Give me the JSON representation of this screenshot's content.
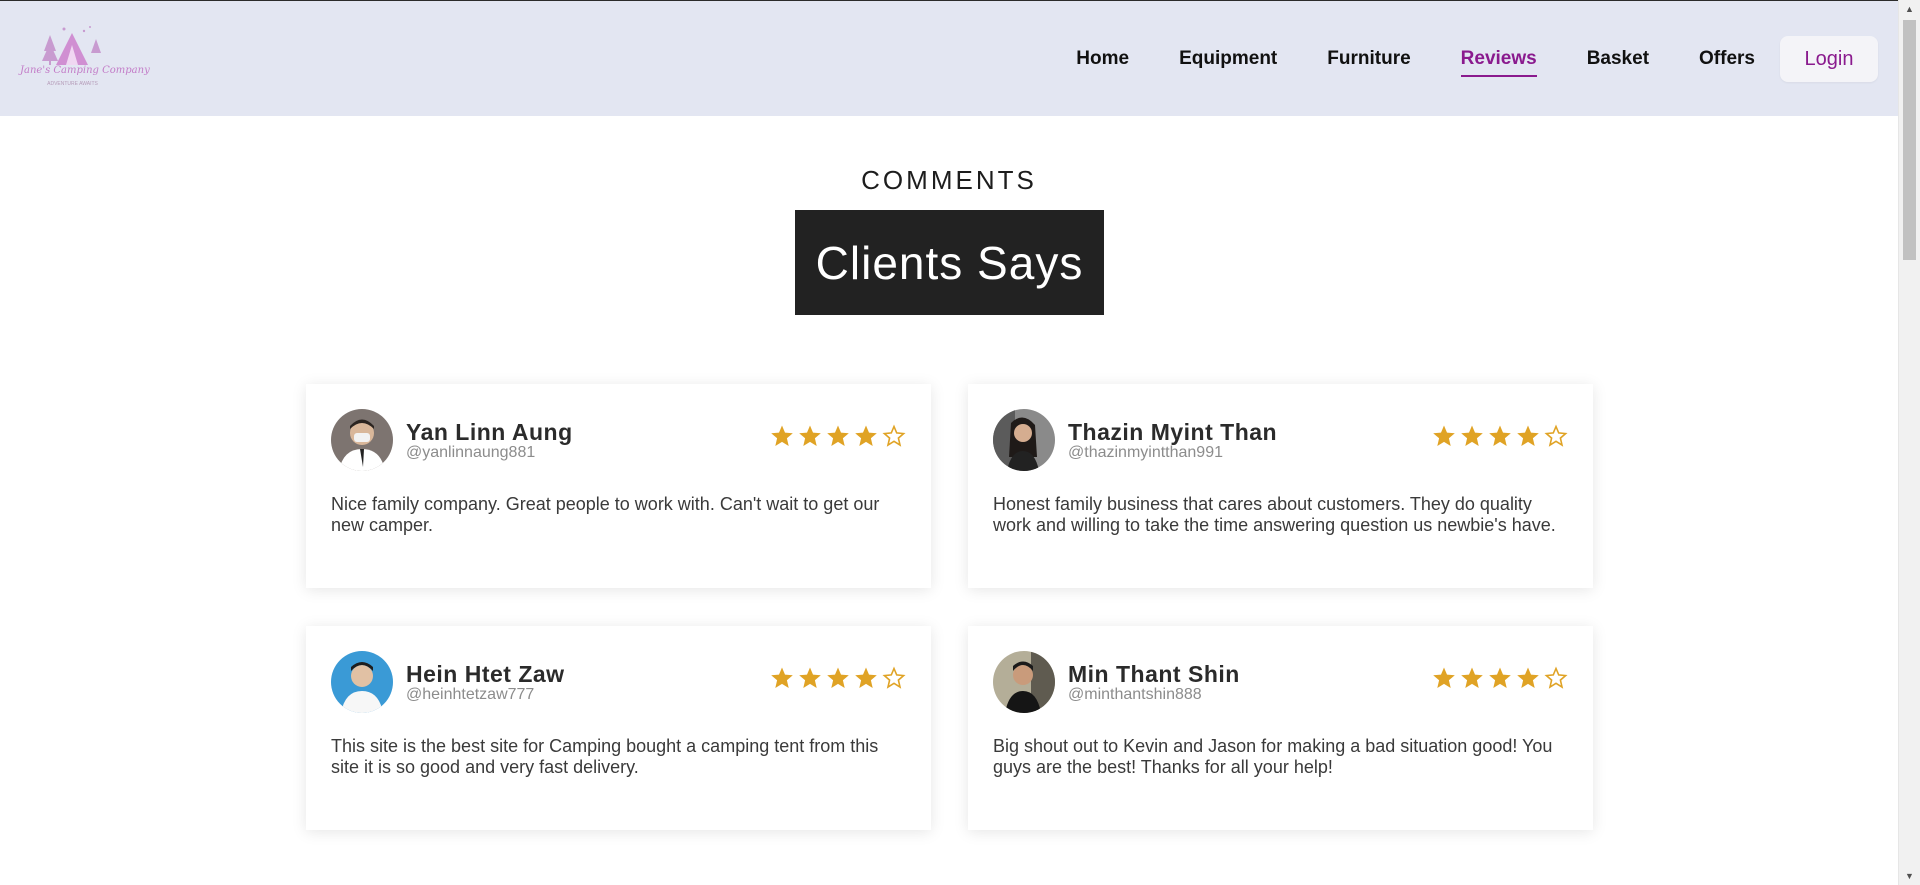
{
  "logo": {
    "name": "Jane's Camping Company",
    "tagline": "ADVENTURE AWAITS"
  },
  "nav": {
    "items": [
      {
        "label": "Home",
        "active": false
      },
      {
        "label": "Equipment",
        "active": false
      },
      {
        "label": "Furniture",
        "active": false
      },
      {
        "label": "Reviews",
        "active": true
      },
      {
        "label": "Basket",
        "active": false
      },
      {
        "label": "Offers",
        "active": false
      }
    ],
    "login_label": "Login"
  },
  "section": {
    "kicker": "COMMENTS",
    "title": "Clients Says"
  },
  "reviews": [
    {
      "name": "Yan Linn Aung",
      "handle": "@yanlinnaung881",
      "rating": 4,
      "max_rating": 5,
      "text": "Nice family company. Great people to work with. Can't wait to get our new camper."
    },
    {
      "name": "Thazin Myint Than",
      "handle": "@thazinmyintthan991",
      "rating": 4,
      "max_rating": 5,
      "text": "Honest family business that cares about customers. They do quality work and willing to take the time answering question us newbie's have."
    },
    {
      "name": "Hein Htet Zaw",
      "handle": "@heinhtetzaw777",
      "rating": 4,
      "max_rating": 5,
      "text": "This site is the best site for Camping bought a camping tent from this site it is so good and very fast delivery."
    },
    {
      "name": "Min Thant Shin",
      "handle": "@minthantshin888",
      "rating": 4,
      "max_rating": 5,
      "text": "Big shout out to Kevin and Jason for making a bad situation good! You guys are the best! Thanks for all your help!"
    }
  ],
  "colors": {
    "header_bg": "#e3e6f2",
    "accent": "#8a1a8e",
    "star": "#e0a325",
    "title_box_bg": "#222222"
  }
}
